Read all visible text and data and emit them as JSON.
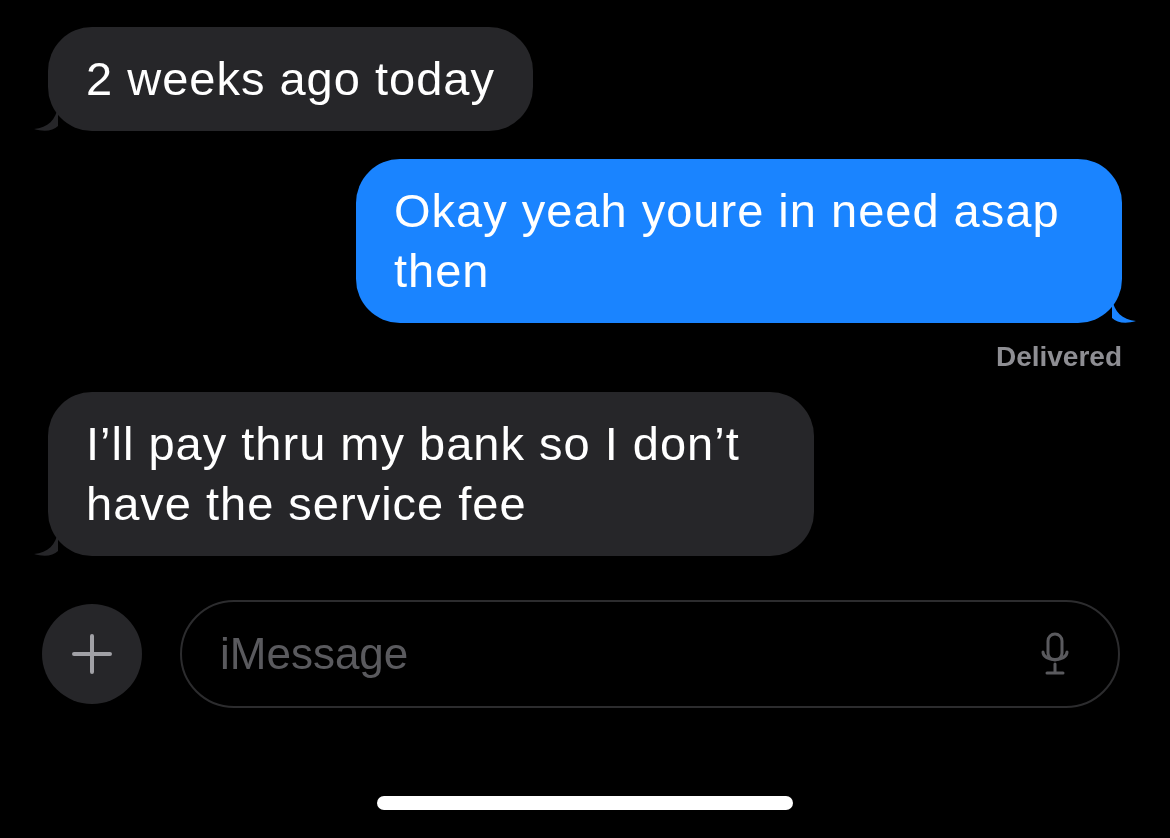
{
  "messages": [
    {
      "kind": "incoming",
      "text": "2 weeks ago today"
    },
    {
      "kind": "outgoing",
      "text": "Okay yeah youre in need asap then",
      "status": "Delivered"
    },
    {
      "kind": "incoming",
      "text": "I’ll pay thru my bank so I don’t have the service fee"
    }
  ],
  "composer": {
    "placeholder": "iMessage"
  }
}
